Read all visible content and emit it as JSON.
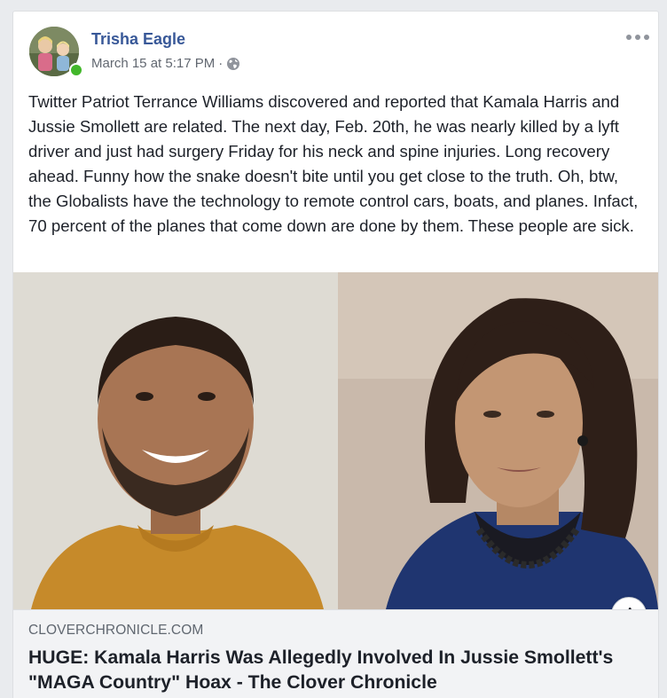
{
  "post": {
    "author": "Trisha Eagle",
    "timestamp": "March 15 at 5:17 PM",
    "separator": "·",
    "privacy_icon": "globe-icon",
    "more_icon": "more-options-icon",
    "text": "Twitter Patriot Terrance Williams discovered and reported that Kamala Harris and Jussie Smollett are related. The next day, Feb. 20th, he was nearly killed by a lyft driver and just had surgery Friday for his neck and spine injuries. Long recovery ahead. Funny how the snake doesn't bite until you get close to the truth. Oh, btw, the Globalists have the technology to remote control cars, boats, and planes. Infact, 70 percent of the planes that come down are done by them. These people are sick.",
    "online_status_color": "#42b72a"
  },
  "link_preview": {
    "domain": "CLOVERCHRONICLE.COM",
    "title": "HUGE: Kamala Harris Was Allegedly Involved In Jussie Smollett's \"MAGA Country\" Hoax - The Clover Chronicle",
    "info_label": "i"
  },
  "colors": {
    "author_link": "#385898",
    "meta_text": "#616770",
    "body_text": "#1d2129",
    "page_bg": "#e9ebee",
    "link_box_bg": "#f2f3f5"
  }
}
